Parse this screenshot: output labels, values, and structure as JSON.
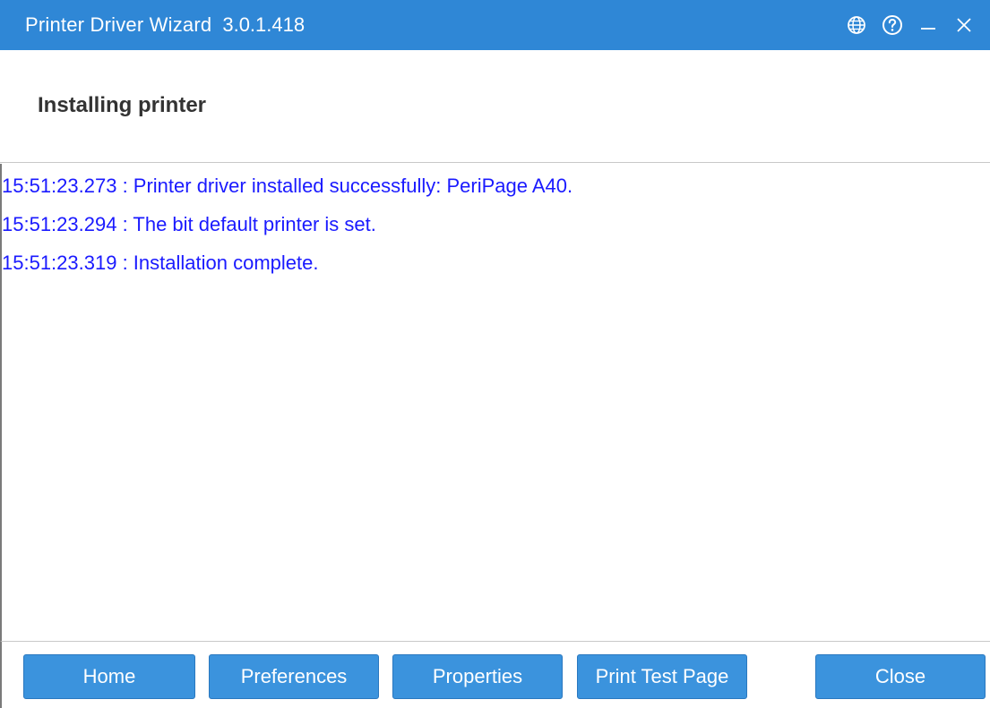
{
  "titlebar": {
    "app_name": "Printer Driver Wizard",
    "version": "3.0.1.418",
    "icons": [
      "globe-icon",
      "help-icon",
      "minimize-icon",
      "close-icon"
    ]
  },
  "header": {
    "title": "Installing printer"
  },
  "log": {
    "lines": [
      "15:51:23.273 : Printer driver installed successfully: PeriPage A40.",
      "15:51:23.294 : The bit default printer is set.",
      "15:51:23.319 : Installation complete."
    ]
  },
  "footer": {
    "home_label": "Home",
    "preferences_label": "Preferences",
    "properties_label": "Properties",
    "print_test_label": "Print Test Page",
    "close_label": "Close"
  },
  "colors": {
    "titlebar_bg": "#2f87d6",
    "button_bg": "#3b93dd",
    "log_text": "#1a1aff"
  }
}
